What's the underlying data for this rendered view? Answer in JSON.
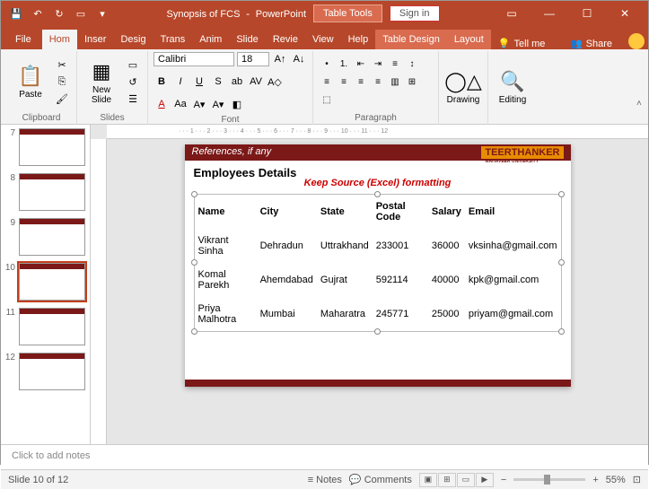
{
  "titlebar": {
    "doc": "Synopsis of FCS",
    "app": "PowerPoint",
    "tooltab": "Table Tools",
    "signin": "Sign in"
  },
  "tabs": {
    "file": "File",
    "home": "Hom",
    "insert": "Inser",
    "design": "Desig",
    "trans": "Trans",
    "anim": "Anim",
    "slide": "Slide",
    "review": "Revie",
    "view": "View",
    "help": "Help",
    "tdesign": "Table Design",
    "layout": "Layout",
    "tellme": "Tell me",
    "share": "Share"
  },
  "ribbon": {
    "clipboard": {
      "paste": "Paste",
      "label": "Clipboard"
    },
    "slides": {
      "new": "New\nSlide",
      "label": "Slides"
    },
    "font": {
      "name": "Calibri",
      "size": "18",
      "label": "Font"
    },
    "paragraph": {
      "label": "Paragraph"
    },
    "drawing": {
      "btn": "Drawing",
      "label": ""
    },
    "editing": {
      "btn": "Editing",
      "label": ""
    }
  },
  "thumbs": [
    {
      "n": "7"
    },
    {
      "n": "8"
    },
    {
      "n": "9"
    },
    {
      "n": "10",
      "active": true
    },
    {
      "n": "11"
    },
    {
      "n": "12"
    }
  ],
  "slide": {
    "ref": "References, if any",
    "uni1": "TEERTHANKER",
    "uni2": "MAHAVEER UNIVERSITY",
    "title": "Employees Details",
    "note": "Keep Source (Excel) formatting",
    "headers": [
      "Name",
      "City",
      "State",
      "Postal Code",
      "Salary",
      "Email"
    ],
    "rows": [
      [
        "Vikrant Sinha",
        "Dehradun",
        "Uttrakhand",
        "233001",
        "36000",
        "vksinha@gmail.com"
      ],
      [
        "Komal Parekh",
        "Ahemdabad",
        "Gujrat",
        "592114",
        "40000",
        "kpk@gmail.com"
      ],
      [
        "Priya Malhotra",
        "Mumbai",
        "Maharatra",
        "245771",
        "25000",
        "priyam@gmail.com"
      ]
    ]
  },
  "notes": "Click to add notes",
  "status": {
    "slide": "Slide 10 of 12",
    "notes": "Notes",
    "comments": "Comments",
    "zoom": "55%"
  }
}
